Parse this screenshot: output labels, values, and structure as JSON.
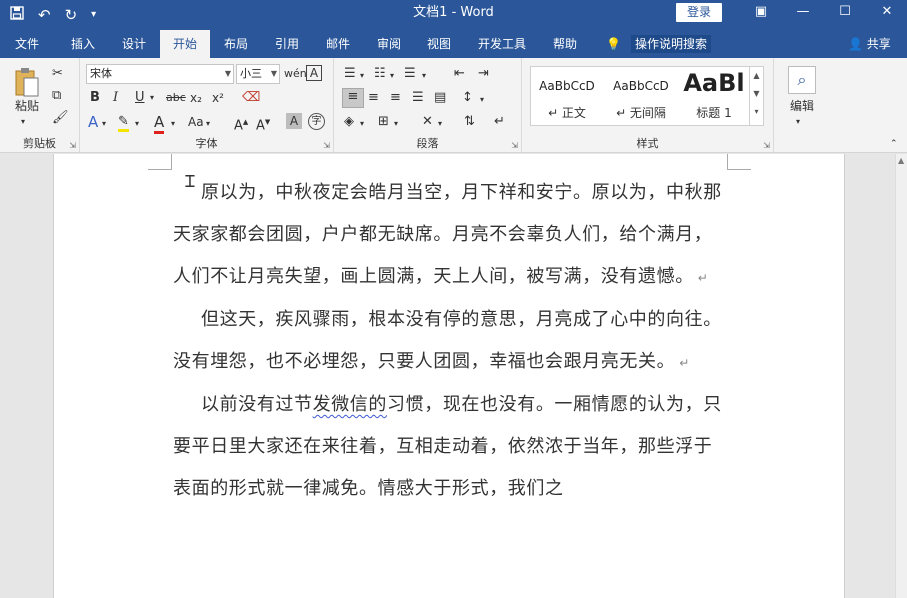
{
  "titlebar": {
    "doc_title": "文档1  -  Word",
    "login_label": "登录",
    "qat_icons": [
      "save-icon",
      "undo-icon",
      "redo-icon",
      "customize-qat-icon"
    ],
    "window_icons": [
      "ribbon-display-icon",
      "minimize-icon",
      "maximize-icon",
      "close-icon"
    ]
  },
  "tabs": [
    {
      "label": "文件"
    },
    {
      "label": "插入"
    },
    {
      "label": "设计"
    },
    {
      "label": "开始"
    },
    {
      "label": "布局"
    },
    {
      "label": "引用"
    },
    {
      "label": "邮件"
    },
    {
      "label": "审阅"
    },
    {
      "label": "视图"
    },
    {
      "label": "开发工具"
    },
    {
      "label": "帮助"
    }
  ],
  "active_tab": "开始",
  "tell_me": "操作说明搜索",
  "share_label": "共享",
  "ribbon": {
    "clipboard": {
      "label": "剪贴板",
      "paste_label": "粘贴"
    },
    "font": {
      "label": "字体",
      "font_name": "宋体",
      "font_size": "小三"
    },
    "paragraph": {
      "label": "段落"
    },
    "styles": {
      "label": "样式",
      "items": [
        {
          "sample": "AaBbCcD",
          "name": "↵ 正文"
        },
        {
          "sample": "AaBbCcD",
          "name": "↵ 无间隔"
        },
        {
          "sample": "AaBl",
          "name": "标题 1"
        }
      ]
    },
    "editing": {
      "label": "编辑"
    }
  },
  "document": {
    "paragraphs": [
      "原以为，中秋夜定会皓月当空，月下祥和安宁。原以为，中秋那天家家都会团圆，户户都无缺席。月亮不会辜负人们，给个满月，人们不让月亮失望，画上圆满，天上人间，被写满，没有遗憾。",
      "但这天，疾风骤雨，根本没有停的意思，月亮成了心中的向往。没有埋怨，也不必埋怨，只要人团圆，幸福也会跟月亮无关。"
    ],
    "p3_before": "以前没有过节",
    "p3_squiggle": "发微信的",
    "p3_after": "习惯，现在也没有。一厢情愿的认为，只要平日里大家还在来往着，互相走动着，依然浓于当年，那些浮于表面的形式就一律减免。情感大于形式，我们之",
    "paragraph_mark": "↵"
  }
}
